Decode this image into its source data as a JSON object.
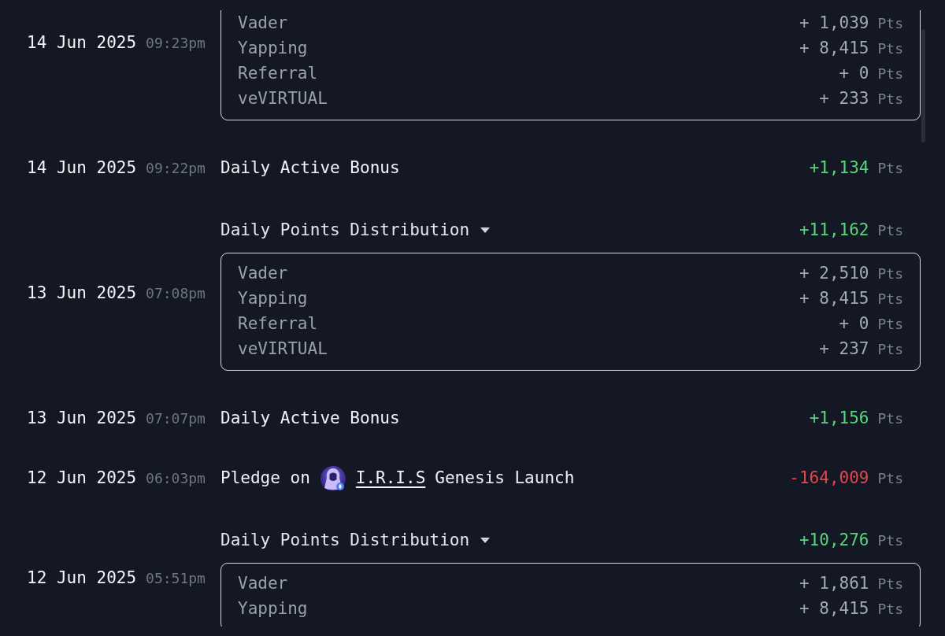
{
  "history": [
    {
      "kind": "distribution",
      "date": "14 Jun 2025",
      "time": "09:23pm",
      "expanded": true,
      "breakdown": [
        {
          "label": "Vader",
          "amount": "+ 1,039",
          "unit": "Pts"
        },
        {
          "label": "Yapping",
          "amount": "+ 8,415",
          "unit": "Pts"
        },
        {
          "label": "Referral",
          "amount": "+ 0",
          "unit": "Pts"
        },
        {
          "label": "veVIRTUAL",
          "amount": "+ 233",
          "unit": "Pts"
        }
      ]
    },
    {
      "kind": "bonus",
      "date": "14 Jun 2025",
      "time": "09:22pm",
      "title": "Daily Active Bonus",
      "amount": "+1,134",
      "unit": "Pts",
      "color": "#5ad47c"
    },
    {
      "kind": "distribution",
      "date": "13 Jun 2025",
      "time": "07:08pm",
      "title": "Daily Points Distribution",
      "expanded": true,
      "amount": "+11,162",
      "unit": "Pts",
      "color": "#5ad47c",
      "breakdown": [
        {
          "label": "Vader",
          "amount": "+ 2,510",
          "unit": "Pts"
        },
        {
          "label": "Yapping",
          "amount": "+ 8,415",
          "unit": "Pts"
        },
        {
          "label": "Referral",
          "amount": "+ 0",
          "unit": "Pts"
        },
        {
          "label": "veVIRTUAL",
          "amount": "+ 237",
          "unit": "Pts"
        }
      ]
    },
    {
      "kind": "bonus",
      "date": "13 Jun 2025",
      "time": "07:07pm",
      "title": "Daily Active Bonus",
      "amount": "+1,156",
      "unit": "Pts",
      "color": "#5ad47c"
    },
    {
      "kind": "pledge",
      "date": "12 Jun 2025",
      "time": "06:03pm",
      "prefix": "Pledge on",
      "project": "I.R.I.S",
      "suffix": "Genesis Launch",
      "amount": "-164,009",
      "unit": "Pts",
      "color": "#e0484c"
    },
    {
      "kind": "distribution",
      "date": "12 Jun 2025",
      "time": "05:51pm",
      "title": "Daily Points Distribution",
      "expanded": true,
      "amount": "+10,276",
      "unit": "Pts",
      "color": "#5ad47c",
      "breakdown": [
        {
          "label": "Vader",
          "amount": "+ 1,861",
          "unit": "Pts"
        },
        {
          "label": "Yapping",
          "amount": "+ 8,415",
          "unit": "Pts"
        }
      ]
    }
  ]
}
